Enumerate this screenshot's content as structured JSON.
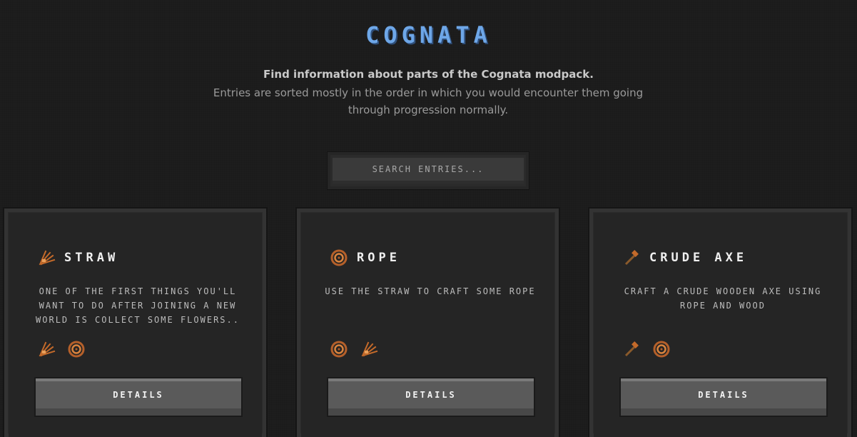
{
  "header": {
    "title": "COGNATA",
    "subtitle": "Find information about parts of the Cognata modpack.",
    "description": "Entries are sorted mostly in the order in which you would encounter them going through progression normally."
  },
  "search": {
    "placeholder": "SEARCH ENTRIES..."
  },
  "colors": {
    "title_blue": "#6ea7e8",
    "item_orange": "#c46a2a"
  },
  "entries": [
    {
      "title": "STRAW",
      "icon": "straw-icon",
      "description": "ONE OF THE FIRST THINGS YOU'LL WANT TO DO AFTER JOINING A NEW WORLD IS COLLECT SOME FLOWERS..",
      "items": [
        "straw-icon",
        "rope-icon"
      ],
      "button_label": "DETAILS"
    },
    {
      "title": "ROPE",
      "icon": "rope-icon",
      "description": "USE THE STRAW TO CRAFT SOME ROPE",
      "items": [
        "rope-icon",
        "straw-icon"
      ],
      "button_label": "DETAILS"
    },
    {
      "title": "CRUDE AXE",
      "icon": "axe-icon",
      "description": "CRAFT A CRUDE WOODEN AXE USING ROPE AND WOOD",
      "items": [
        "axe-icon",
        "rope-icon"
      ],
      "button_label": "DETAILS"
    }
  ]
}
